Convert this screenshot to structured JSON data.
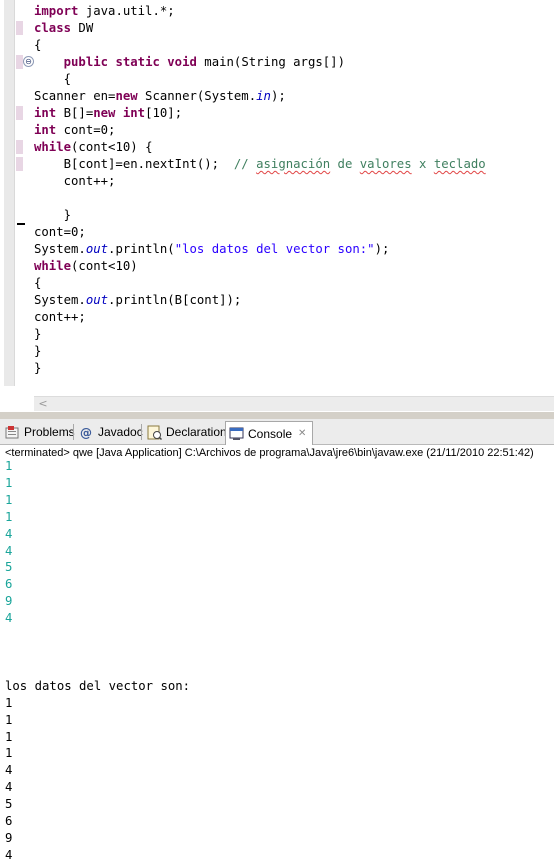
{
  "editor": {
    "code_lines": [
      [
        {
          "t": "import",
          "c": "kw"
        },
        {
          "t": " java.util.*;"
        }
      ],
      [
        {
          "t": "class",
          "c": "kw"
        },
        {
          "t": " DW"
        }
      ],
      [
        {
          "t": "{"
        }
      ],
      [
        {
          "t": "    "
        },
        {
          "t": "public",
          "c": "kw"
        },
        {
          "t": " "
        },
        {
          "t": "static",
          "c": "kw"
        },
        {
          "t": " "
        },
        {
          "t": "void",
          "c": "kw"
        },
        {
          "t": " main(String args[])"
        }
      ],
      [
        {
          "t": "    {"
        }
      ],
      [
        {
          "t": "Scanner en="
        },
        {
          "t": "new",
          "c": "kw"
        },
        {
          "t": " Scanner(System."
        },
        {
          "t": "in",
          "c": "st"
        },
        {
          "t": ");"
        }
      ],
      [
        {
          "t": "int",
          "c": "kw"
        },
        {
          "t": " B[]="
        },
        {
          "t": "new",
          "c": "kw"
        },
        {
          "t": " "
        },
        {
          "t": "int",
          "c": "kw"
        },
        {
          "t": "[10];"
        }
      ],
      [
        {
          "t": "int",
          "c": "kw"
        },
        {
          "t": " cont=0;"
        }
      ],
      [
        {
          "t": "while",
          "c": "kw"
        },
        {
          "t": "(cont<10) {"
        }
      ],
      [
        {
          "t": "    B[cont]=en.nextInt();  "
        },
        {
          "t": "// ",
          "c": "cm"
        },
        {
          "t": "asignación",
          "c": "cm sp"
        },
        {
          "t": " de ",
          "c": "cm"
        },
        {
          "t": "valores",
          "c": "cm sp"
        },
        {
          "t": " x ",
          "c": "cm"
        },
        {
          "t": "teclado",
          "c": "cm sp"
        }
      ],
      [
        {
          "t": "    cont++;"
        }
      ],
      [
        {
          "t": ""
        }
      ],
      [
        {
          "t": "    }"
        }
      ],
      [
        {
          "t": "cont=0;"
        }
      ],
      [
        {
          "t": "System."
        },
        {
          "t": "out",
          "c": "st"
        },
        {
          "t": ".println("
        },
        {
          "t": "\"los datos del vector son:\"",
          "c": "str"
        },
        {
          "t": ");"
        }
      ],
      [
        {
          "t": "while",
          "c": "kw"
        },
        {
          "t": "(cont<10)"
        }
      ],
      [
        {
          "t": "{"
        }
      ],
      [
        {
          "t": "System."
        },
        {
          "t": "out",
          "c": "st"
        },
        {
          "t": ".println(B[cont]);"
        }
      ],
      [
        {
          "t": "cont++;"
        }
      ],
      [
        {
          "t": "}"
        }
      ],
      [
        {
          "t": "}"
        }
      ],
      [
        {
          "t": "}"
        }
      ]
    ],
    "marked_lines": [
      1,
      3,
      6,
      8,
      9
    ],
    "scroll_left_glyph": "<"
  },
  "console_view": {
    "tabs": [
      {
        "label": "Problems",
        "icon": "problems-icon",
        "active": false
      },
      {
        "label": "Javadoc",
        "icon": "javadoc-icon",
        "active": false
      },
      {
        "label": "Declaration",
        "icon": "declaration-icon",
        "active": false
      },
      {
        "label": "Console",
        "icon": "console-icon",
        "active": true,
        "close_glyph": "✕"
      }
    ],
    "status": "<terminated> qwe [Java Application] C:\\Archivos de programa\\Java\\jre6\\bin\\javaw.exe (21/11/2010 22:51:42)",
    "input_lines": [
      "1",
      "1",
      "1",
      "1",
      "4",
      "4",
      "5",
      "6",
      "9",
      "4"
    ],
    "header_output": "los datos del vector son:",
    "output_lines": [
      "1",
      "1",
      "1",
      "1",
      "4",
      "4",
      "5",
      "6",
      "9",
      "4"
    ],
    "colors": {
      "input": "#1aa59a",
      "output": "#000000"
    }
  }
}
